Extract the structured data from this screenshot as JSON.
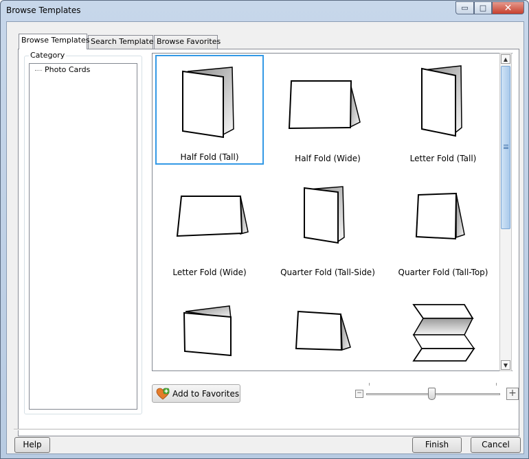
{
  "window": {
    "title": "Browse Templates"
  },
  "caption_buttons": {
    "minimize": "▭",
    "maximize": "□",
    "close": "✕"
  },
  "tabs": [
    {
      "label": "Browse Templates",
      "active": true
    },
    {
      "label": "Search Templates",
      "active": false
    },
    {
      "label": "Browse Favorites",
      "active": false
    }
  ],
  "category": {
    "label": "Category",
    "items": [
      {
        "label": "Photo Cards"
      }
    ]
  },
  "templates": [
    {
      "label": "Half Fold (Tall)",
      "icon": "half-fold-tall-icon",
      "selected": true
    },
    {
      "label": "Half Fold (Wide)",
      "icon": "half-fold-wide-icon",
      "selected": false
    },
    {
      "label": "Letter Fold (Tall)",
      "icon": "letter-fold-tall-icon",
      "selected": false
    },
    {
      "label": "Letter Fold (Wide)",
      "icon": "letter-fold-wide-icon",
      "selected": false
    },
    {
      "label": "Quarter Fold (Tall-Side)",
      "icon": "quarter-fold-tall-side-icon",
      "selected": false
    },
    {
      "label": "Quarter Fold (Tall-Top)",
      "icon": "quarter-fold-tall-top-icon",
      "selected": false
    },
    {
      "label": "",
      "icon": "top-fold-tall-icon",
      "selected": false
    },
    {
      "label": "",
      "icon": "tent-fold-icon",
      "selected": false
    },
    {
      "label": "",
      "icon": "accordion-fold-icon",
      "selected": false
    }
  ],
  "actions": {
    "add_to_favorites": "Add to Favorites"
  },
  "zoom": {
    "minus": "−",
    "plus": "+",
    "level": 0.5
  },
  "footer": {
    "help": "Help",
    "finish": "Finish",
    "cancel": "Cancel"
  },
  "colors": {
    "selection": "#3399e6",
    "accent": "#b8cbe2"
  }
}
